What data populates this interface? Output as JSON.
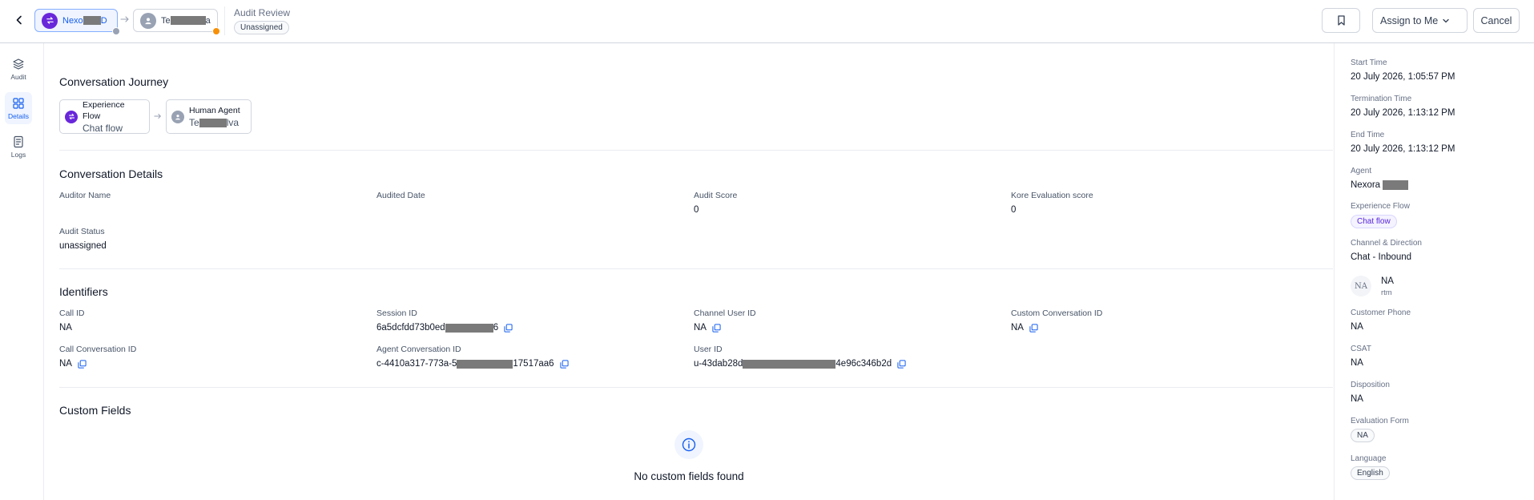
{
  "header": {
    "chip_agent": {
      "prefix": "Nexo",
      "suffix": "D"
    },
    "chip_user": {
      "prefix": "Te",
      "suffix": "a"
    },
    "audit_review": "Audit Review",
    "audit_status_pill": "Unassigned",
    "assign_label": "Assign to Me",
    "cancel_label": "Cancel"
  },
  "rail": {
    "items": [
      {
        "label": "Audit"
      },
      {
        "label": "Details"
      },
      {
        "label": "Logs"
      }
    ]
  },
  "journey": {
    "title": "Conversation Journey",
    "step1": {
      "label": "Experience Flow",
      "value": "Chat flow"
    },
    "step2": {
      "label": "Human Agent",
      "value_prefix": "Te",
      "value_suffix": "lva"
    }
  },
  "details": {
    "title": "Conversation Details",
    "auditor_name_label": "Auditor Name",
    "audited_date_label": "Audited Date",
    "audit_score_label": "Audit Score",
    "audit_score_value": "0",
    "kore_score_label": "Kore Evaluation score",
    "kore_score_value": "0",
    "audit_status_label": "Audit Status",
    "audit_status_value": "unassigned"
  },
  "identifiers": {
    "title": "Identifiers",
    "call_id_label": "Call ID",
    "call_id_value": "NA",
    "session_id_label": "Session ID",
    "session_id_prefix": "6a5dcfdd73b0ed",
    "session_id_suffix": "6",
    "channel_user_id_label": "Channel User ID",
    "channel_user_id_value": "NA",
    "custom_conv_id_label": "Custom Conversation ID",
    "custom_conv_id_value": "NA",
    "call_conv_id_label": "Call Conversation ID",
    "call_conv_id_value": "NA",
    "agent_conv_id_label": "Agent Conversation ID",
    "agent_conv_id_prefix": "c-4410a317-773a-5",
    "agent_conv_id_suffix": "17517aa6",
    "user_id_label": "User ID",
    "user_id_prefix": "u-43dab28d",
    "user_id_suffix": "4e96c346b2d"
  },
  "custom_fields": {
    "title": "Custom Fields",
    "empty_text": "No custom fields found"
  },
  "summary": {
    "start_time_label": "Start Time",
    "start_time_value": "20 July 2026, 1:05:57 PM",
    "termination_time_label": "Termination Time",
    "termination_time_value": "20 July 2026, 1:13:12 PM",
    "end_time_label": "End Time",
    "end_time_value": "20 July 2026, 1:13:12 PM",
    "agent_label": "Agent",
    "agent_value": "Nexora",
    "experience_flow_label": "Experience Flow",
    "experience_flow_value": "Chat flow",
    "channel_label": "Channel & Direction",
    "channel_value": "Chat - Inbound",
    "customer_avatar": "NA",
    "customer_name": "NA",
    "customer_sub": "rtm",
    "phone_label": "Customer Phone",
    "phone_value": "NA",
    "csat_label": "CSAT",
    "csat_value": "NA",
    "disposition_label": "Disposition",
    "disposition_value": "NA",
    "eval_form_label": "Evaluation Form",
    "eval_form_value": "NA",
    "language_label": "Language",
    "language_value": "English"
  },
  "colors": {
    "accent": "#155eef",
    "purple": "#6927da",
    "border": "#d0d5dd",
    "divider": "#eaecf0"
  }
}
